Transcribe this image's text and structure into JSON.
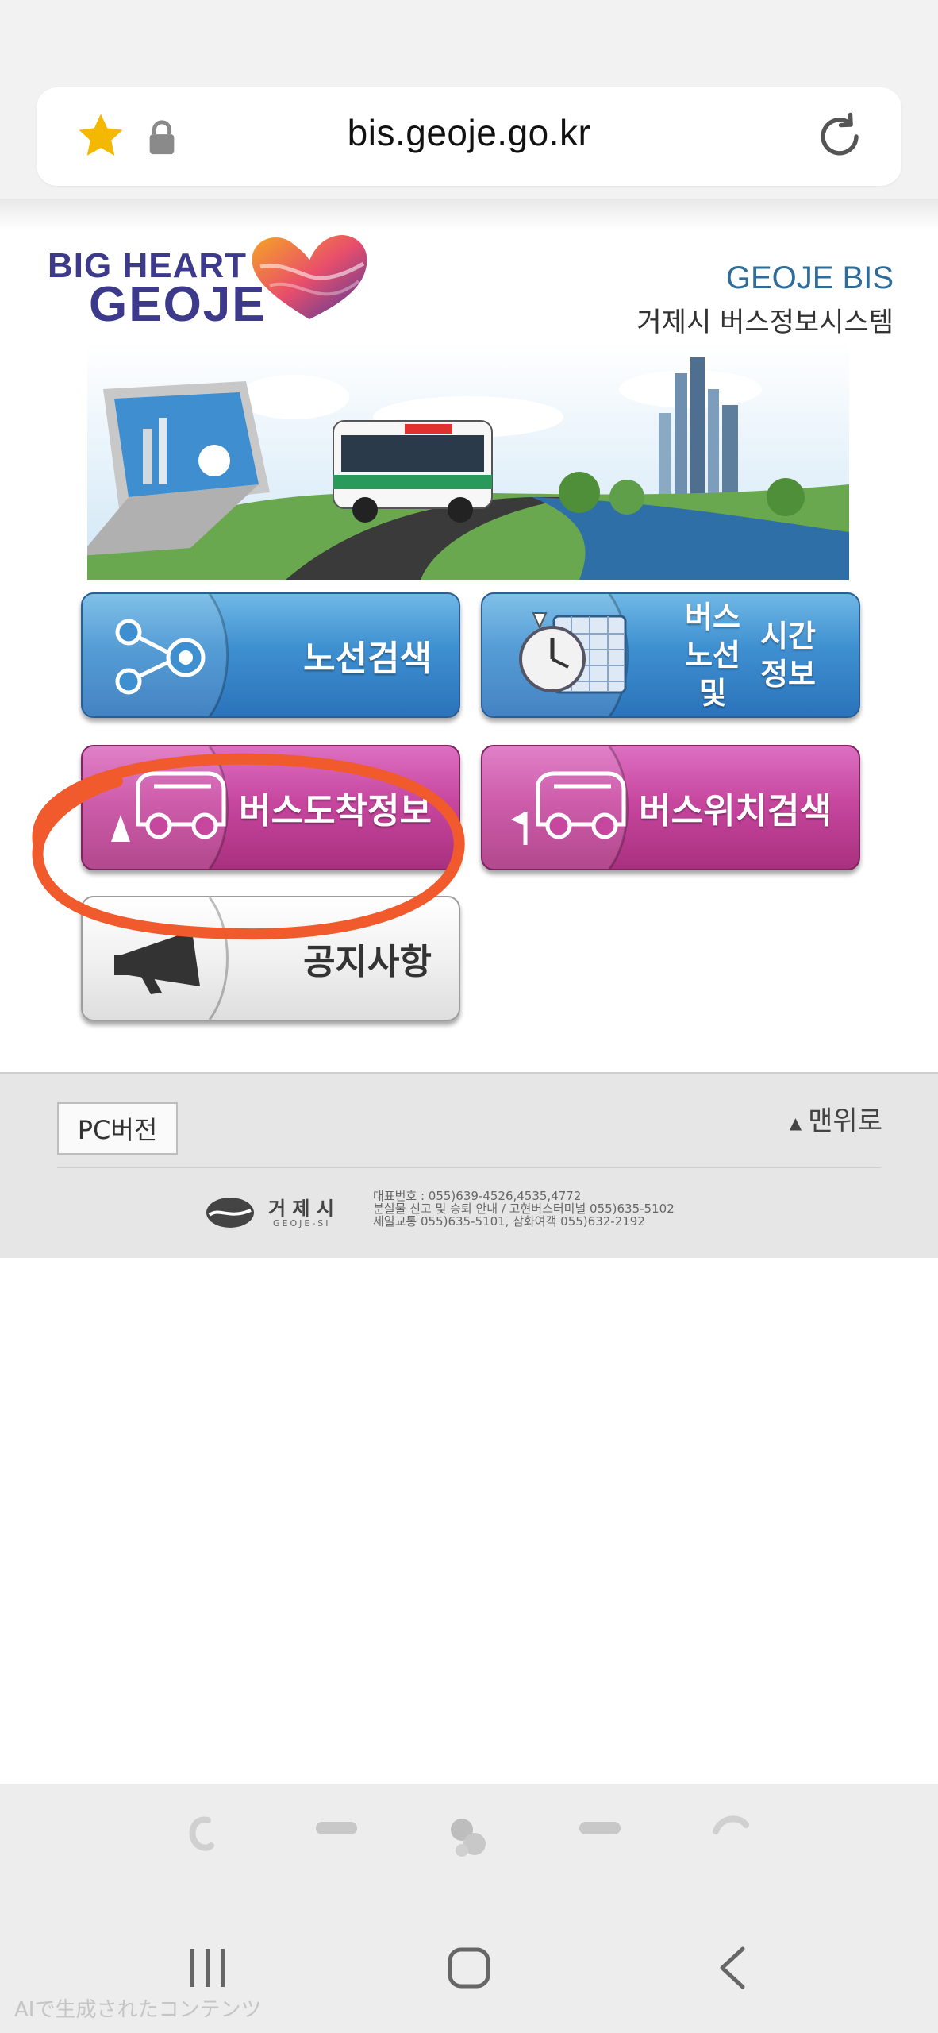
{
  "browser": {
    "url": "bis.geoje.go.kr"
  },
  "header": {
    "logo_line1": "BIG HEART",
    "logo_line2": "GEOJE",
    "system_name_en": "GEOJE BIS",
    "system_name_ko": "거제시 버스정보시스템"
  },
  "menu": {
    "route_search": "노선검색",
    "route_timetable_line1": "버스 노선 및",
    "route_timetable_line2": "시간정보",
    "arrival_info": "버스도착정보",
    "location_search": "버스위치검색",
    "notice": "공지사항"
  },
  "footer": {
    "pc_version": "PC버전",
    "to_top": "맨위로",
    "city_name": "거 제 시",
    "city_name_en": "GEOJE-SI",
    "info_line1": "대표번호 : 055)639-4526,4535,4772",
    "info_line2": "분실물 신고 및 승퇴 안내 / 고현버스터미널 055)635-5102",
    "info_line3": "세일교통 055)635-5101, 삼화여객 055)632-2192"
  },
  "watermark": "AIで生成されたコンテンツ",
  "colors": {
    "button_blue": "#3e8fd0",
    "button_pink": "#c7479f",
    "annotation_circle": "#f05a2c",
    "logo_purple": "#3d3a8c"
  }
}
